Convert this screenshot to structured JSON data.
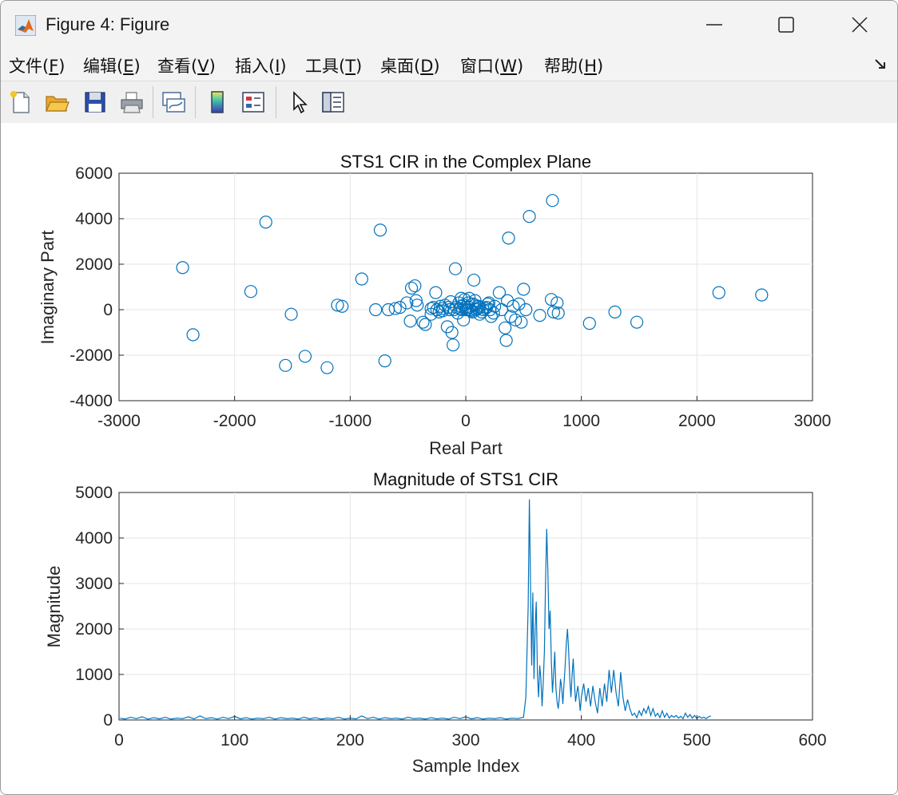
{
  "window": {
    "title": "Figure 4: Figure",
    "icons": [
      "matlab-logo-icon",
      "minimize-icon",
      "maximize-icon",
      "close-icon"
    ]
  },
  "menu": {
    "items": [
      {
        "label": "文件(",
        "key": "F",
        "tail": ")"
      },
      {
        "label": "编辑(",
        "key": "E",
        "tail": ")"
      },
      {
        "label": "查看(",
        "key": "V",
        "tail": ")"
      },
      {
        "label": "插入(",
        "key": "I",
        "tail": ")"
      },
      {
        "label": "工具(",
        "key": "T",
        "tail": ")"
      },
      {
        "label": "桌面(",
        "key": "D",
        "tail": ")"
      },
      {
        "label": "窗口(",
        "key": "W",
        "tail": ")"
      },
      {
        "label": "帮助(",
        "key": "H",
        "tail": ")"
      }
    ]
  },
  "toolbar": {
    "icons": [
      "new-figure-icon",
      "open-file-icon",
      "save-icon",
      "print-icon",
      "link-plot-icon",
      "colorbar-icon",
      "legend-icon",
      "pointer-icon",
      "property-inspector-icon"
    ]
  },
  "colors": {
    "series": "#0072bd",
    "grid": "#e6e6e6",
    "axis": "#262626"
  },
  "chart_data": [
    {
      "type": "scatter",
      "title": "STS1 CIR in the Complex Plane",
      "xlabel": "Real Part",
      "ylabel": "Imaginary Part",
      "xlim": [
        -3000,
        3000
      ],
      "ylim": [
        -4000,
        6000
      ],
      "xticks": [
        "-3000",
        "-2000",
        "-1000",
        "0",
        "1000",
        "2000",
        "3000"
      ],
      "yticks": [
        "6000",
        "4000",
        "2000",
        "0",
        "-2000",
        "-4000"
      ],
      "grid": true,
      "marker": "open-circle",
      "points": [
        [
          -2450,
          1850
        ],
        [
          -2360,
          -1100
        ],
        [
          -1860,
          800
        ],
        [
          -1730,
          3850
        ],
        [
          -1560,
          -2450
        ],
        [
          -1510,
          -200
        ],
        [
          -1390,
          -2050
        ],
        [
          -1200,
          -2550
        ],
        [
          -1110,
          200
        ],
        [
          -1070,
          150
        ],
        [
          -900,
          1350
        ],
        [
          -780,
          0
        ],
        [
          -740,
          3500
        ],
        [
          -700,
          -2250
        ],
        [
          -670,
          0
        ],
        [
          -610,
          50
        ],
        [
          -570,
          100
        ],
        [
          -510,
          300
        ],
        [
          -480,
          -500
        ],
        [
          -470,
          950
        ],
        [
          -440,
          1050
        ],
        [
          -430,
          400
        ],
        [
          -420,
          200
        ],
        [
          -370,
          -550
        ],
        [
          -350,
          -650
        ],
        [
          -300,
          -200
        ],
        [
          -280,
          100
        ],
        [
          -260,
          750
        ],
        [
          -230,
          -100
        ],
        [
          -200,
          50
        ],
        [
          -180,
          200
        ],
        [
          -160,
          -750
        ],
        [
          -140,
          0
        ],
        [
          -120,
          -1000
        ],
        [
          -110,
          -1550
        ],
        [
          -90,
          1800
        ],
        [
          -80,
          100
        ],
        [
          -60,
          300
        ],
        [
          -40,
          500
        ],
        [
          -30,
          0
        ],
        [
          -20,
          -450
        ],
        [
          0,
          100
        ],
        [
          20,
          300
        ],
        [
          40,
          0
        ],
        [
          60,
          -100
        ],
        [
          70,
          1300
        ],
        [
          80,
          200
        ],
        [
          100,
          50
        ],
        [
          120,
          -200
        ],
        [
          150,
          0
        ],
        [
          180,
          100
        ],
        [
          200,
          300
        ],
        [
          220,
          -300
        ],
        [
          250,
          150
        ],
        [
          290,
          750
        ],
        [
          310,
          0
        ],
        [
          340,
          -800
        ],
        [
          350,
          -1350
        ],
        [
          360,
          400
        ],
        [
          370,
          3150
        ],
        [
          390,
          -300
        ],
        [
          410,
          150
        ],
        [
          430,
          -450
        ],
        [
          460,
          250
        ],
        [
          480,
          -550
        ],
        [
          500,
          900
        ],
        [
          520,
          0
        ],
        [
          550,
          4100
        ],
        [
          640,
          -250
        ],
        [
          740,
          450
        ],
        [
          750,
          4800
        ],
        [
          760,
          -100
        ],
        [
          790,
          300
        ],
        [
          800,
          -150
        ],
        [
          1070,
          -600
        ],
        [
          1290,
          -100
        ],
        [
          1480,
          -550
        ],
        [
          2190,
          750
        ],
        [
          2560,
          650
        ],
        [
          -300,
          50
        ],
        [
          -250,
          0
        ],
        [
          -200,
          -50
        ],
        [
          -150,
          100
        ],
        [
          -100,
          0
        ],
        [
          -50,
          50
        ],
        [
          -20,
          200
        ],
        [
          10,
          0
        ],
        [
          30,
          100
        ],
        [
          60,
          250
        ],
        [
          90,
          0
        ],
        [
          110,
          150
        ],
        [
          140,
          -100
        ],
        [
          170,
          50
        ],
        [
          210,
          0
        ],
        [
          240,
          -150
        ],
        [
          -10,
          450
        ],
        [
          30,
          500
        ],
        [
          80,
          400
        ],
        [
          -70,
          -150
        ],
        [
          -40,
          150
        ],
        [
          0,
          0
        ],
        [
          50,
          -50
        ],
        [
          120,
          100
        ],
        [
          -220,
          150
        ],
        [
          -130,
          350
        ],
        [
          190,
          250
        ]
      ]
    },
    {
      "type": "line",
      "title": "Magnitude of STS1 CIR",
      "xlabel": "Sample Index",
      "ylabel": "Magnitude",
      "xlim": [
        0,
        600
      ],
      "ylim": [
        0,
        5000
      ],
      "xticks": [
        "0",
        "100",
        "200",
        "300",
        "400",
        "500",
        "600"
      ],
      "yticks": [
        "5000",
        "4000",
        "3000",
        "2000",
        "1000",
        "0"
      ],
      "grid": true,
      "points": [
        [
          1,
          40
        ],
        [
          5,
          20
        ],
        [
          10,
          60
        ],
        [
          15,
          30
        ],
        [
          20,
          70
        ],
        [
          25,
          20
        ],
        [
          30,
          50
        ],
        [
          35,
          25
        ],
        [
          40,
          60
        ],
        [
          45,
          20
        ],
        [
          50,
          40
        ],
        [
          55,
          30
        ],
        [
          60,
          70
        ],
        [
          65,
          25
        ],
        [
          70,
          90
        ],
        [
          75,
          30
        ],
        [
          80,
          50
        ],
        [
          85,
          20
        ],
        [
          90,
          60
        ],
        [
          95,
          30
        ],
        [
          100,
          80
        ],
        [
          105,
          25
        ],
        [
          110,
          50
        ],
        [
          115,
          20
        ],
        [
          120,
          40
        ],
        [
          125,
          30
        ],
        [
          130,
          60
        ],
        [
          135,
          20
        ],
        [
          140,
          50
        ],
        [
          145,
          30
        ],
        [
          150,
          40
        ],
        [
          155,
          20
        ],
        [
          160,
          60
        ],
        [
          165,
          25
        ],
        [
          170,
          50
        ],
        [
          175,
          20
        ],
        [
          180,
          40
        ],
        [
          185,
          30
        ],
        [
          190,
          60
        ],
        [
          195,
          20
        ],
        [
          200,
          40
        ],
        [
          205,
          25
        ],
        [
          210,
          90
        ],
        [
          215,
          30
        ],
        [
          220,
          60
        ],
        [
          225,
          20
        ],
        [
          230,
          50
        ],
        [
          235,
          30
        ],
        [
          240,
          40
        ],
        [
          245,
          20
        ],
        [
          250,
          60
        ],
        [
          255,
          30
        ],
        [
          260,
          40
        ],
        [
          265,
          20
        ],
        [
          270,
          50
        ],
        [
          275,
          25
        ],
        [
          280,
          40
        ],
        [
          285,
          20
        ],
        [
          290,
          60
        ],
        [
          295,
          30
        ],
        [
          300,
          70
        ],
        [
          305,
          25
        ],
        [
          310,
          50
        ],
        [
          315,
          20
        ],
        [
          320,
          40
        ],
        [
          325,
          30
        ],
        [
          330,
          50
        ],
        [
          335,
          20
        ],
        [
          340,
          40
        ],
        [
          345,
          30
        ],
        [
          350,
          60
        ],
        [
          352,
          500
        ],
        [
          354,
          2500
        ],
        [
          355,
          4850
        ],
        [
          356,
          3000
        ],
        [
          357,
          1200
        ],
        [
          358,
          2800
        ],
        [
          359,
          900
        ],
        [
          360,
          2000
        ],
        [
          361,
          2600
        ],
        [
          362,
          1000
        ],
        [
          363,
          500
        ],
        [
          364,
          1200
        ],
        [
          365,
          900
        ],
        [
          366,
          300
        ],
        [
          367,
          800
        ],
        [
          368,
          1500
        ],
        [
          369,
          3000
        ],
        [
          370,
          4200
        ],
        [
          371,
          3300
        ],
        [
          372,
          2000
        ],
        [
          373,
          2400
        ],
        [
          374,
          1300
        ],
        [
          375,
          600
        ],
        [
          376,
          1000
        ],
        [
          377,
          1500
        ],
        [
          378,
          700
        ],
        [
          379,
          400
        ],
        [
          380,
          250
        ],
        [
          381,
          500
        ],
        [
          382,
          900
        ],
        [
          383,
          700
        ],
        [
          384,
          350
        ],
        [
          385,
          800
        ],
        [
          386,
          1200
        ],
        [
          387,
          1700
        ],
        [
          388,
          2000
        ],
        [
          389,
          1500
        ],
        [
          390,
          900
        ],
        [
          391,
          500
        ],
        [
          392,
          1000
        ],
        [
          393,
          1350
        ],
        [
          394,
          800
        ],
        [
          395,
          400
        ],
        [
          396,
          600
        ],
        [
          397,
          750
        ],
        [
          398,
          500
        ],
        [
          399,
          200
        ],
        [
          400,
          500
        ],
        [
          402,
          800
        ],
        [
          404,
          400
        ],
        [
          406,
          700
        ],
        [
          408,
          300
        ],
        [
          410,
          750
        ],
        [
          412,
          400
        ],
        [
          414,
          150
        ],
        [
          416,
          700
        ],
        [
          418,
          300
        ],
        [
          420,
          800
        ],
        [
          422,
          400
        ],
        [
          424,
          1100
        ],
        [
          426,
          600
        ],
        [
          428,
          1100
        ],
        [
          430,
          600
        ],
        [
          432,
          300
        ],
        [
          434,
          1050
        ],
        [
          436,
          500
        ],
        [
          438,
          200
        ],
        [
          440,
          450
        ],
        [
          442,
          250
        ],
        [
          444,
          100
        ],
        [
          446,
          150
        ],
        [
          448,
          50
        ],
        [
          450,
          200
        ],
        [
          452,
          100
        ],
        [
          454,
          250
        ],
        [
          456,
          150
        ],
        [
          458,
          300
        ],
        [
          460,
          100
        ],
        [
          462,
          250
        ],
        [
          464,
          80
        ],
        [
          466,
          150
        ],
        [
          468,
          50
        ],
        [
          470,
          200
        ],
        [
          472,
          60
        ],
        [
          474,
          150
        ],
        [
          476,
          40
        ],
        [
          478,
          100
        ],
        [
          480,
          60
        ],
        [
          482,
          100
        ],
        [
          484,
          40
        ],
        [
          486,
          80
        ],
        [
          488,
          30
        ],
        [
          490,
          150
        ],
        [
          492,
          60
        ],
        [
          494,
          120
        ],
        [
          496,
          40
        ],
        [
          498,
          100
        ],
        [
          500,
          30
        ],
        [
          502,
          80
        ],
        [
          504,
          40
        ],
        [
          506,
          60
        ],
        [
          508,
          30
        ],
        [
          510,
          70
        ],
        [
          512,
          90
        ]
      ]
    }
  ]
}
